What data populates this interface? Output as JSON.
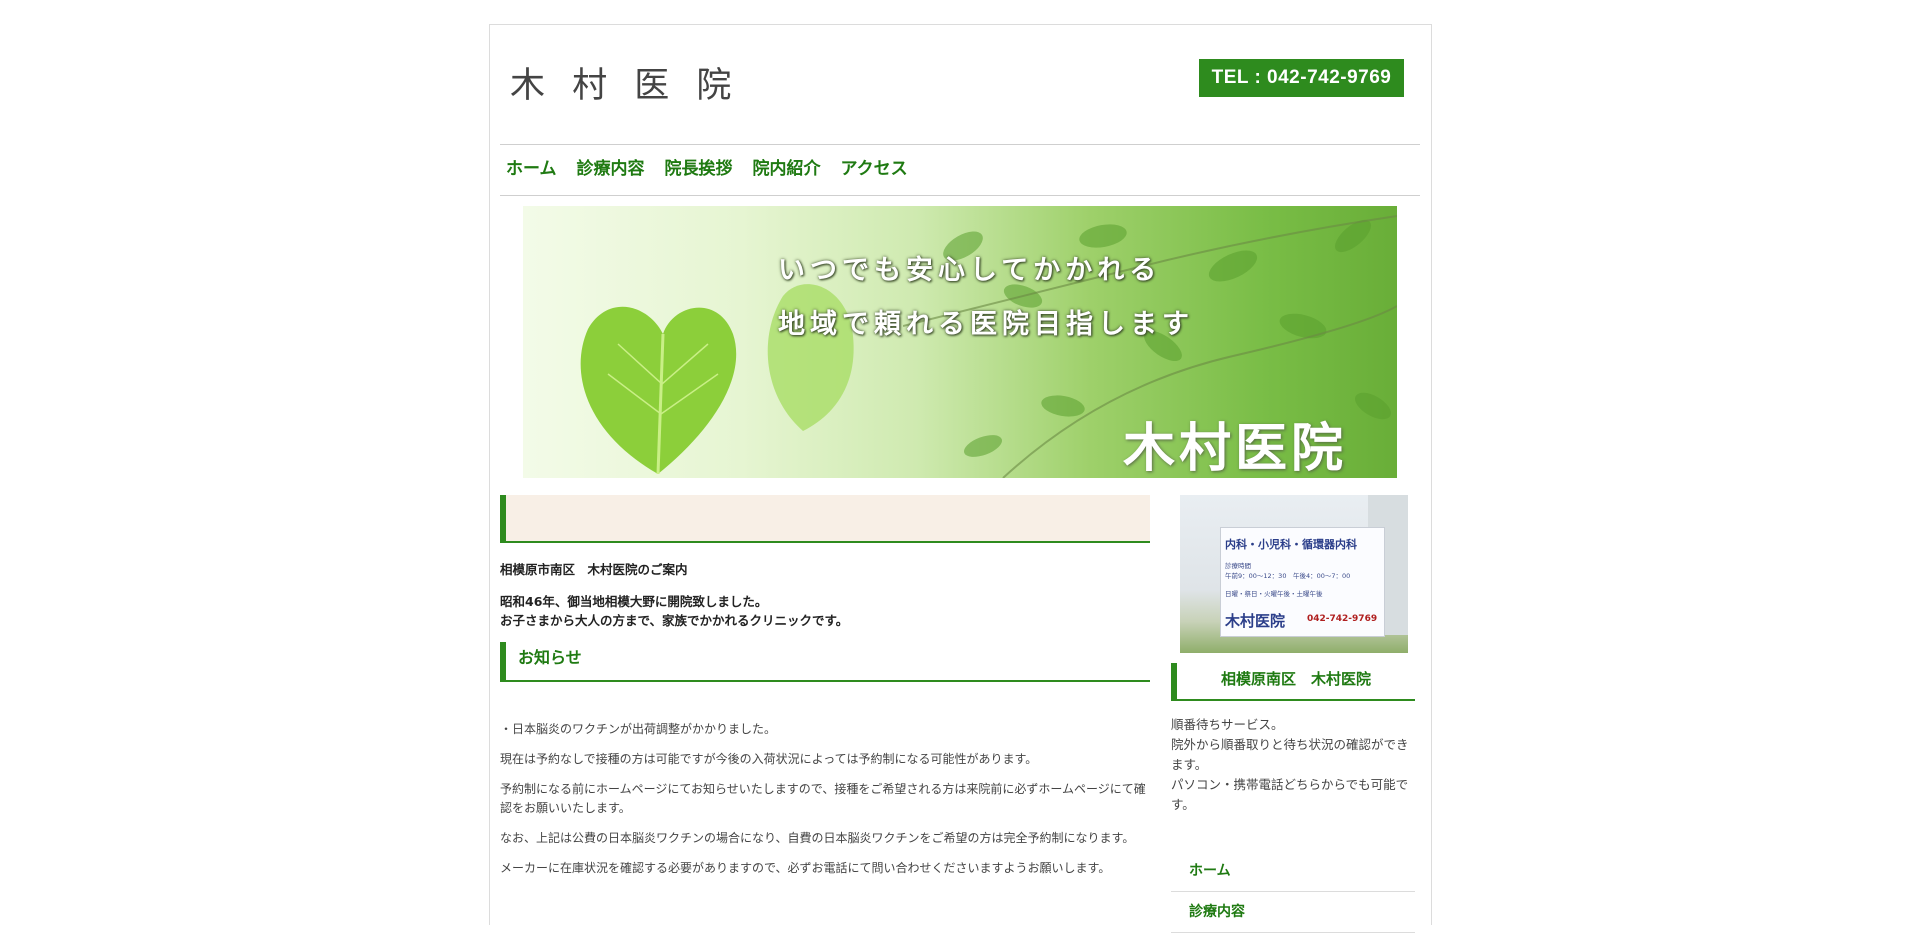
{
  "header": {
    "logo": "木 村 医 院",
    "tel": "TEL : 042-742-9769"
  },
  "nav": [
    "ホーム",
    "診療内容",
    "院長挨拶",
    "院内紹介",
    "アクセス"
  ],
  "hero": {
    "line1": "いつでも安心してかかれる",
    "line2": "地域で頼れる医院目指します",
    "name": "木村医院"
  },
  "main": {
    "intro_head": "相模原市南区　木村医院のご案内",
    "intro_line1": "昭和46年、御当地相模大野に開院致しました。",
    "intro_line2": "お子さまから大人の方まで、家族でかかれるクリニックです。",
    "news_title": "お知らせ",
    "news": [
      "・日本脳炎のワクチンが出荷調整がかかりました。",
      "現在は予約なしで接種の方は可能ですが今後の入荷状況によっては予約制になる可能性があります。",
      "予約制になる前にホームページにてお知らせいたしますので、接種をご希望される方は来院前に必ずホームページにて確認をお願いいたします。",
      "なお、上記は公費の日本脳炎ワクチンの場合になり、自費の日本脳炎ワクチンをご希望の方は完全予約制になります。",
      "メーカーに在庫状況を確認する必要がありますので、必ずお電話にて問い合わせくださいますようお願いします。"
    ]
  },
  "sidebar": {
    "sign": {
      "title": "内科・小児科・循環器内科",
      "hours_label": "診療時間",
      "hours": "午前9：00～12：30　午後4：00～7：00",
      "closed": "日曜・祭日・火曜午後・土曜午後",
      "name": "木村医院",
      "phone": "042-742-9769"
    },
    "title": "相模原南区　木村医院",
    "text_line1": "順番待ちサービス。",
    "text_line2": "院外から順番取りと待ち状況の確認ができます。",
    "text_line3": "パソコン・携帯電話どちらからでも可能です。",
    "nav": [
      "ホーム",
      "診療内容"
    ]
  }
}
